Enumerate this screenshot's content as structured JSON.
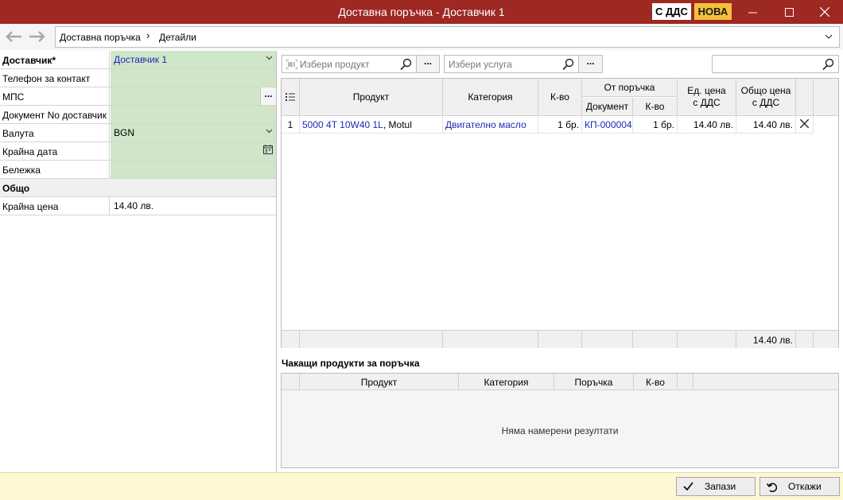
{
  "window": {
    "title": "Доставна поръчка - Доставчик 1",
    "badge_vat": "С ДДС",
    "badge_status": "НОВА",
    "accent_color": "#9e2822",
    "badge_status_color": "#f3c13a"
  },
  "nav": {
    "back_icon": "arrow-left-icon",
    "forward_icon": "arrow-right-icon",
    "breadcrumb_root": "Доставна поръчка",
    "breadcrumb_separator": "›",
    "breadcrumb_leaf": "Детайли"
  },
  "form": {
    "supplier_label": "Доставчик*",
    "supplier_value": "Доставчик 1",
    "phone_label": "Телефон за контакт",
    "phone_value": "",
    "vehicle_label": "МПС",
    "vehicle_value": "",
    "vehicle_button": "...",
    "doc_label": "Документ No доставчик",
    "doc_value": "",
    "currency_label": "Валута",
    "currency_value": "BGN",
    "deadline_label": "Крайна дата",
    "deadline_value": "",
    "note_label": "Бележка",
    "note_value": "",
    "total_section": "Общо",
    "final_price_label": "Крайна цена",
    "final_price_value": "14.40 лв.",
    "editable_color": "#cfe6c9"
  },
  "toolbar": {
    "product_placeholder": "Избери продукт",
    "product_more": "...",
    "service_placeholder": "Избери услуга",
    "service_more": "...",
    "search_value": ""
  },
  "grid": {
    "headers": {
      "product": "Продукт",
      "category": "Категория",
      "qty": "К-во",
      "from_order": "От поръчка",
      "document": "Документ",
      "order_qty": "К-во",
      "unit_price_l1": "Ед. цена",
      "unit_price_l2": "с ДДС",
      "total_l1": "Общо цена",
      "total_l2": "с ДДС"
    },
    "rows": [
      {
        "num": "1",
        "product_link": "5000 4T 10W40 1L",
        "product_suffix": ", Motul",
        "category": "Двигателно масло",
        "qty": "1 бр.",
        "document": "КП-000004",
        "order_qty": "1 бр.",
        "unit_price": "14.40 лв.",
        "total": "14.40 лв."
      }
    ],
    "footer_total": "14.40 лв."
  },
  "pending": {
    "title": "Чакащи продукти за поръчка",
    "headers": {
      "product": "Продукт",
      "category": "Категория",
      "order": "Поръчка",
      "qty": "К-во"
    },
    "empty_text": "Няма намерени резултати"
  },
  "footer": {
    "save_label": "Запази",
    "cancel_label": "Откажи",
    "background": "#fdf7d3"
  }
}
